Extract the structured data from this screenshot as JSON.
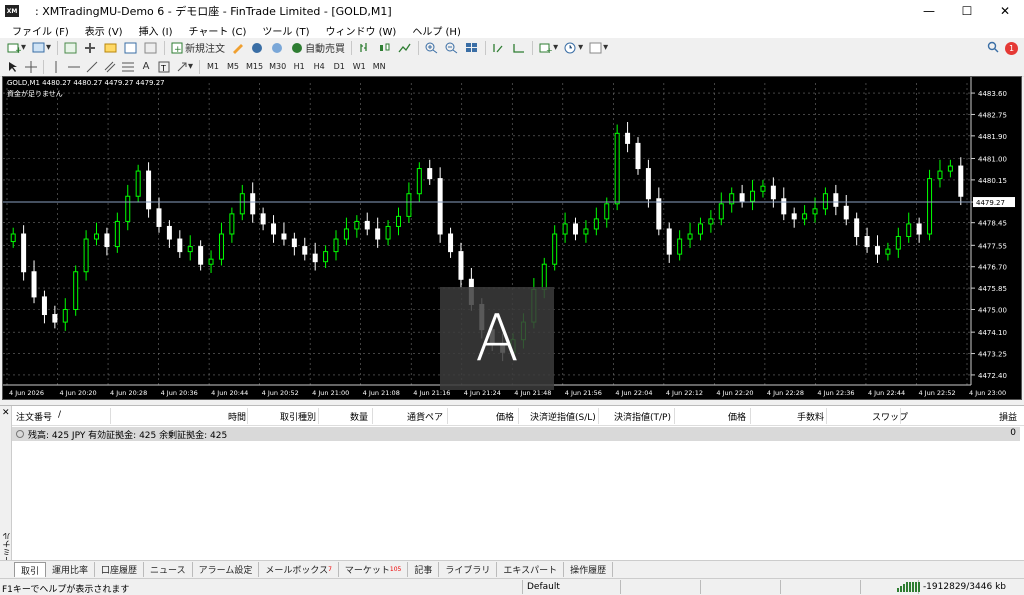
{
  "window": {
    "title": ": XMTradingMU-Demo 6 - デモロ座 - FinTrade Limited - [GOLD,M1]",
    "minimize": "—",
    "maximize": "☐",
    "close": "✕"
  },
  "menu": [
    "ファイル (F)",
    "表示 (V)",
    "挿入 (I)",
    "チャート (C)",
    "ツール (T)",
    "ウィンドウ (W)",
    "ヘルプ (H)"
  ],
  "toolbar": {
    "new_order": "新規注文",
    "auto_trade": "自動売買",
    "notification_count": "1"
  },
  "timeframes": [
    "M1",
    "M5",
    "M15",
    "M30",
    "H1",
    "H4",
    "D1",
    "W1",
    "MN"
  ],
  "chart": {
    "symbol_line": "GOLD,M1  4480.27 4480.27 4479.27 4479.27",
    "sub_line": "資金が足りません",
    "current_price": "4479.27",
    "overlay_letter": "A"
  },
  "chart_data": {
    "type": "candlestick",
    "price_axis": [
      "4483.60",
      "4482.75",
      "4481.90",
      "4481.00",
      "4480.15",
      "4479.27",
      "4478.45",
      "4477.55",
      "4476.70",
      "4475.85",
      "4475.00",
      "4474.10",
      "4473.25",
      "4472.40"
    ],
    "time_axis": [
      "4 Jun 2026",
      "4 Jun 20:20",
      "4 Jun 20:28",
      "4 Jun 20:36",
      "4 Jun 20:44",
      "4 Jun 20:52",
      "4 Jun 21:00",
      "4 Jun 21:08",
      "4 Jun 21:16",
      "4 Jun 21:24",
      "4 Jun 21:48",
      "4 Jun 21:56",
      "4 Jun 22:04",
      "4 Jun 22:12",
      "4 Jun 22:20",
      "4 Jun 22:28",
      "4 Jun 22:36",
      "4 Jun 22:44",
      "4 Jun 22:52",
      "4 Jun 23:00"
    ],
    "ylim": [
      4472.0,
      4484.0
    ],
    "closes": [
      4478.0,
      4476.5,
      4475.5,
      4474.8,
      4474.5,
      4475.0,
      4476.5,
      4477.8,
      4478.0,
      4477.5,
      4478.5,
      4479.5,
      4480.5,
      4479.0,
      4478.3,
      4477.8,
      4477.3,
      4477.5,
      4476.8,
      4477.0,
      4478.0,
      4478.8,
      4479.6,
      4478.8,
      4478.4,
      4478.0,
      4477.8,
      4477.5,
      4477.2,
      4476.9,
      4477.3,
      4477.8,
      4478.2,
      4478.5,
      4478.2,
      4477.8,
      4478.3,
      4478.7,
      4479.6,
      4480.6,
      4480.2,
      4478.0,
      4477.3,
      4476.2,
      4475.2,
      4474.2,
      4473.6,
      4473.3,
      4473.8,
      4474.5,
      4475.8,
      4476.8,
      4478.0,
      4478.4,
      4478.0,
      4478.2,
      4478.6,
      4479.2,
      4482.0,
      4481.6,
      4480.6,
      4479.4,
      4478.2,
      4477.2,
      4477.8,
      4478.0,
      4478.4,
      4478.6,
      4479.2,
      4479.6,
      4479.3,
      4479.7,
      4479.9,
      4479.4,
      4478.8,
      4478.6,
      4478.8,
      4479.0,
      4479.6,
      4479.1,
      4478.6,
      4477.9,
      4477.5,
      4477.2,
      4477.4,
      4477.9,
      4478.4,
      4478.0,
      4480.2,
      4480.5,
      4480.7,
      4479.5
    ],
    "grid": true
  },
  "terminal": {
    "side_label": "ターミナル",
    "columns": [
      "注文番号",
      "/",
      "時間",
      "取引種別",
      "数量",
      "通貨ペア",
      "価格",
      "決済逆指値(S/L)",
      "決済指値(T/P)",
      "価格",
      "手数料",
      "スワップ",
      "損益"
    ],
    "balance_text": "残高: 425 JPY  有効証拠金: 425  余剰証拠金: 425",
    "balance_profit": "0",
    "tabs": [
      {
        "label": "取引",
        "sup": ""
      },
      {
        "label": "運用比率",
        "sup": ""
      },
      {
        "label": "口座履歴",
        "sup": ""
      },
      {
        "label": "ニュース",
        "sup": ""
      },
      {
        "label": "アラーム設定",
        "sup": ""
      },
      {
        "label": "メールボックス",
        "sup": "7"
      },
      {
        "label": "マーケット",
        "sup": "105"
      },
      {
        "label": "記事",
        "sup": ""
      },
      {
        "label": "ライブラリ",
        "sup": ""
      },
      {
        "label": "エキスパート",
        "sup": ""
      },
      {
        "label": "操作履歴",
        "sup": ""
      }
    ]
  },
  "status": {
    "help": "F1キーでヘルプが表示されます",
    "profile": "Default",
    "connection": "-1912829/3446 kb"
  },
  "colors": {
    "bull": "#00ff00",
    "bear": "#ffffff",
    "chart_bg": "#000000",
    "grid": "#6e6e6e",
    "price_line": "#8a9fc0"
  }
}
